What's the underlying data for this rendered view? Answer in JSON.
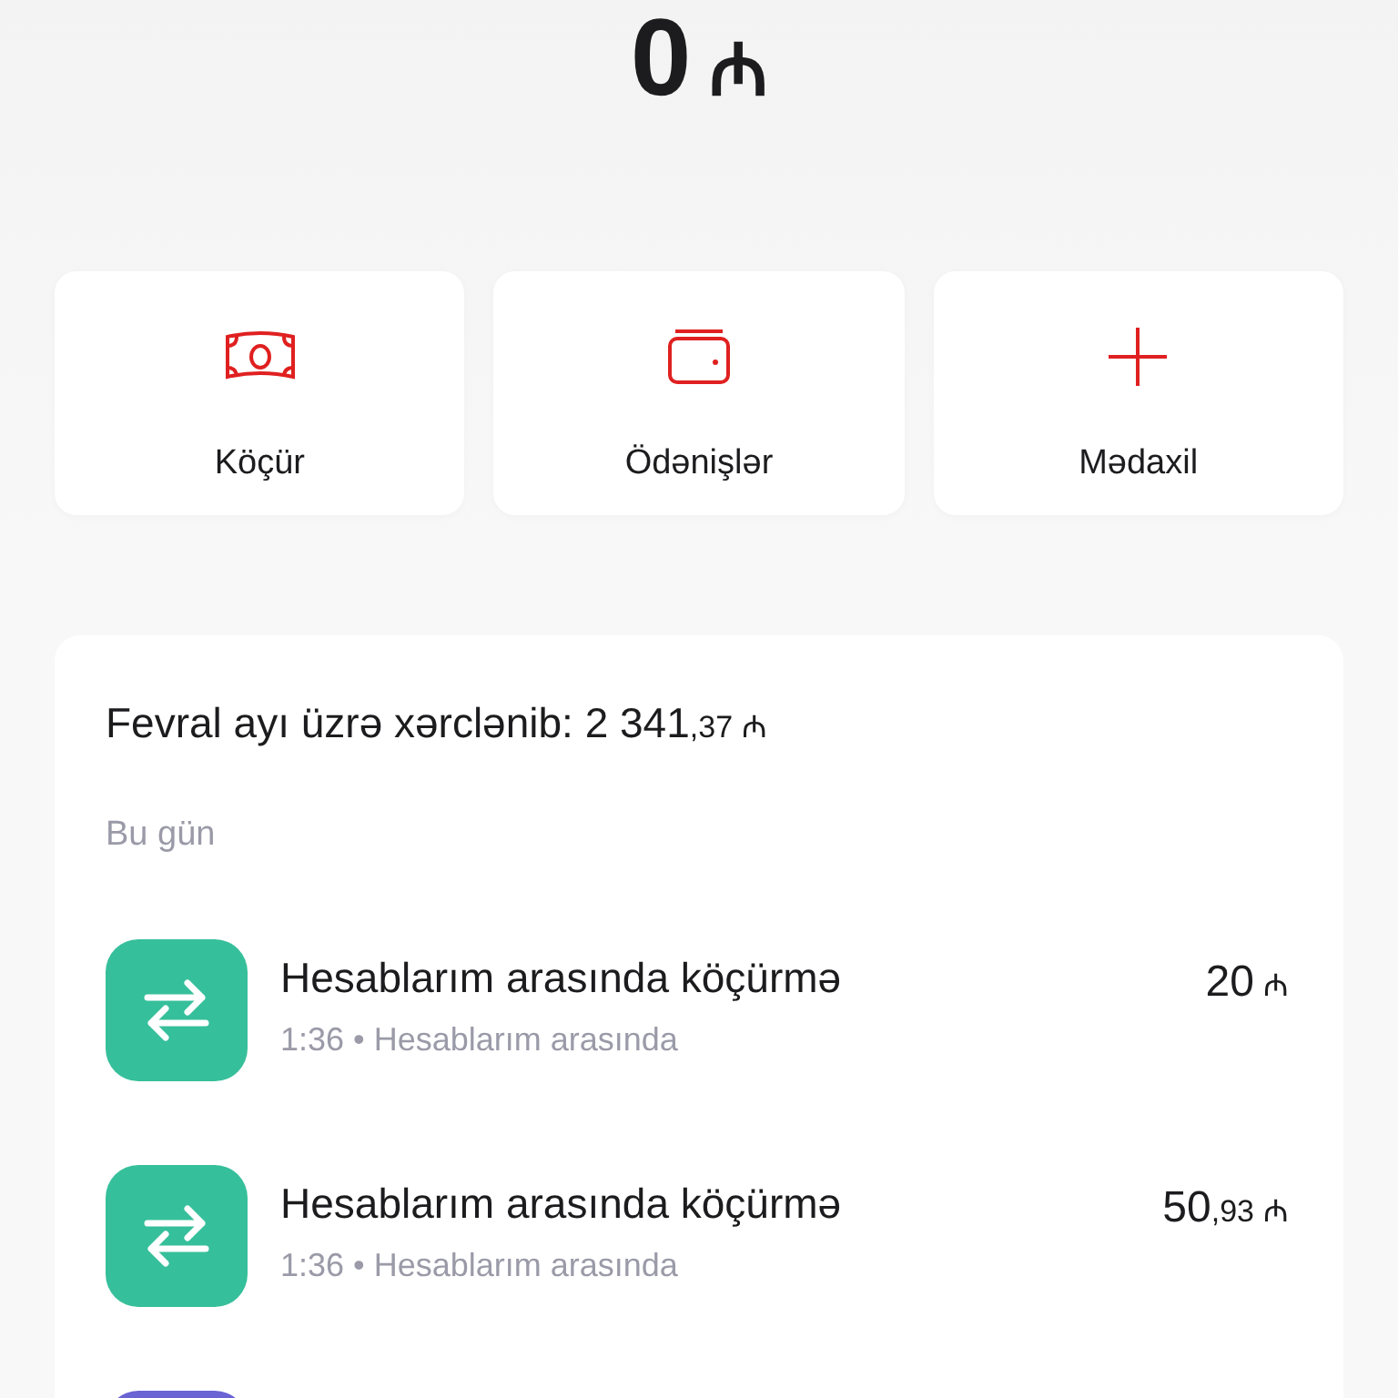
{
  "balance": {
    "amount": "0",
    "currency": "₼"
  },
  "actions": [
    {
      "kind": "transfer",
      "label": "Köçür"
    },
    {
      "kind": "payments",
      "label": "Ödənişlər"
    },
    {
      "kind": "income",
      "label": "Mədaxil"
    }
  ],
  "spending": {
    "label": "Fevral ayı üzrə xərclənib:",
    "whole": "2 341",
    "fraction": ",37",
    "currency": "₼"
  },
  "section": "Bu gün",
  "transactions": [
    {
      "kind": "transfer",
      "color": "#36bf9b",
      "title": "Hesablarım arasında köçürmə",
      "details": "1:36 • Hesablarım arasında",
      "whole": "20",
      "currency": "₼"
    },
    {
      "kind": "transfer",
      "color": "#36bf9b",
      "title": "Hesablarım arasında köçürmə",
      "details": "1:36 • Hesablarım arasında",
      "whole": "50",
      "fraction": ",93",
      "currency": "₼"
    },
    {
      "kind": "blank",
      "color": "#6a63d4"
    }
  ]
}
